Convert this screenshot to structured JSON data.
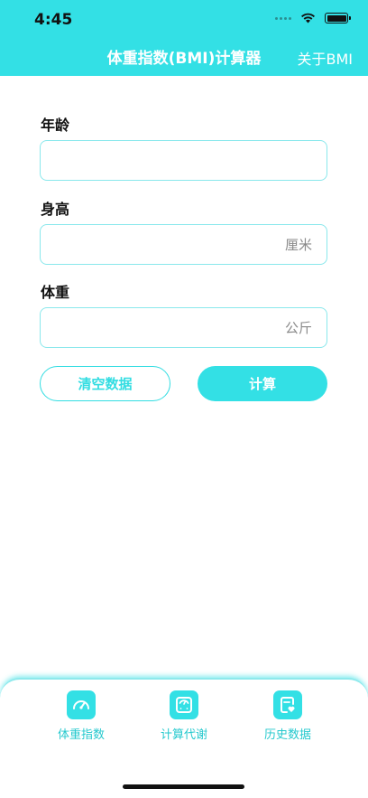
{
  "status_bar": {
    "time": "4:45"
  },
  "nav": {
    "title": "体重指数(BMI)计算器",
    "about_label": "关于BMI"
  },
  "form": {
    "age": {
      "label": "年龄",
      "value": "",
      "unit": ""
    },
    "height": {
      "label": "身高",
      "value": "",
      "unit": "厘米"
    },
    "weight": {
      "label": "体重",
      "value": "",
      "unit": "公斤"
    }
  },
  "actions": {
    "clear_label": "清空数据",
    "calc_label": "计算"
  },
  "tabbar": {
    "items": [
      {
        "label": "体重指数",
        "icon": "gauge-icon"
      },
      {
        "label": "计算代谢",
        "icon": "scale-icon"
      },
      {
        "label": "历史数据",
        "icon": "history-record-icon"
      }
    ]
  },
  "colors": {
    "accent": "#33e0e5",
    "accent_border": "#8ae8ec",
    "unit_text": "#8a8a8a"
  }
}
